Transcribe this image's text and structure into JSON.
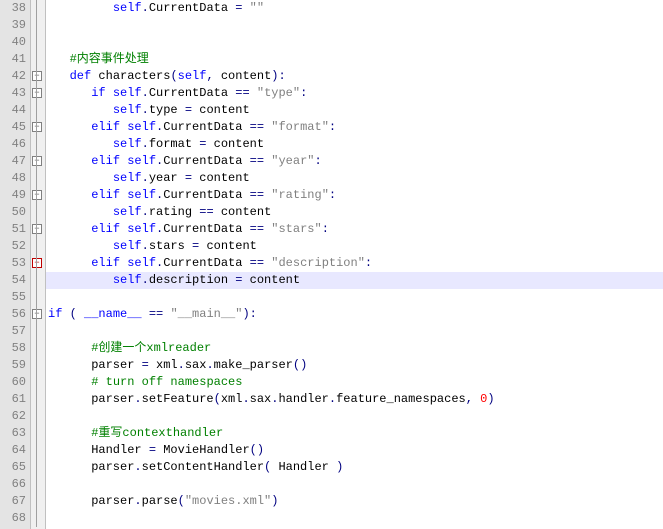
{
  "lines": [
    {
      "num": 38,
      "hl": false,
      "fold": "",
      "tokens": [
        [
          "plain",
          "         "
        ],
        [
          "kw",
          "self"
        ],
        [
          "op",
          "."
        ],
        [
          "plain",
          "CurrentData "
        ],
        [
          "op",
          "="
        ],
        [
          "plain",
          " "
        ],
        [
          "str",
          "\"\""
        ]
      ]
    },
    {
      "num": 39,
      "hl": false,
      "fold": "",
      "tokens": []
    },
    {
      "num": 40,
      "hl": false,
      "fold": "",
      "tokens": []
    },
    {
      "num": 41,
      "hl": false,
      "fold": "",
      "tokens": [
        [
          "plain",
          "   "
        ],
        [
          "comment",
          "#内容事件处理"
        ]
      ]
    },
    {
      "num": 42,
      "hl": false,
      "fold": "minus",
      "tokens": [
        [
          "plain",
          "   "
        ],
        [
          "kw",
          "def"
        ],
        [
          "plain",
          " "
        ],
        [
          "fn",
          "characters"
        ],
        [
          "op",
          "("
        ],
        [
          "kw",
          "self"
        ],
        [
          "op",
          ","
        ],
        [
          "plain",
          " content"
        ],
        [
          "op",
          ")"
        ],
        [
          "op",
          ":"
        ]
      ]
    },
    {
      "num": 43,
      "hl": false,
      "fold": "minus",
      "tokens": [
        [
          "plain",
          "      "
        ],
        [
          "kw",
          "if"
        ],
        [
          "plain",
          " "
        ],
        [
          "kw",
          "self"
        ],
        [
          "op",
          "."
        ],
        [
          "plain",
          "CurrentData "
        ],
        [
          "op",
          "=="
        ],
        [
          "plain",
          " "
        ],
        [
          "str",
          "\"type\""
        ],
        [
          "op",
          ":"
        ]
      ]
    },
    {
      "num": 44,
      "hl": false,
      "fold": "",
      "tokens": [
        [
          "plain",
          "         "
        ],
        [
          "kw",
          "self"
        ],
        [
          "op",
          "."
        ],
        [
          "plain",
          "type "
        ],
        [
          "op",
          "="
        ],
        [
          "plain",
          " content"
        ]
      ]
    },
    {
      "num": 45,
      "hl": false,
      "fold": "minus",
      "tokens": [
        [
          "plain",
          "      "
        ],
        [
          "kw",
          "elif"
        ],
        [
          "plain",
          " "
        ],
        [
          "kw",
          "self"
        ],
        [
          "op",
          "."
        ],
        [
          "plain",
          "CurrentData "
        ],
        [
          "op",
          "=="
        ],
        [
          "plain",
          " "
        ],
        [
          "str",
          "\"format\""
        ],
        [
          "op",
          ":"
        ]
      ]
    },
    {
      "num": 46,
      "hl": false,
      "fold": "",
      "tokens": [
        [
          "plain",
          "         "
        ],
        [
          "kw",
          "self"
        ],
        [
          "op",
          "."
        ],
        [
          "plain",
          "format "
        ],
        [
          "op",
          "="
        ],
        [
          "plain",
          " content"
        ]
      ]
    },
    {
      "num": 47,
      "hl": false,
      "fold": "minus",
      "tokens": [
        [
          "plain",
          "      "
        ],
        [
          "kw",
          "elif"
        ],
        [
          "plain",
          " "
        ],
        [
          "kw",
          "self"
        ],
        [
          "op",
          "."
        ],
        [
          "plain",
          "CurrentData "
        ],
        [
          "op",
          "=="
        ],
        [
          "plain",
          " "
        ],
        [
          "str",
          "\"year\""
        ],
        [
          "op",
          ":"
        ]
      ]
    },
    {
      "num": 48,
      "hl": false,
      "fold": "",
      "tokens": [
        [
          "plain",
          "         "
        ],
        [
          "kw",
          "self"
        ],
        [
          "op",
          "."
        ],
        [
          "plain",
          "year "
        ],
        [
          "op",
          "="
        ],
        [
          "plain",
          " content"
        ]
      ]
    },
    {
      "num": 49,
      "hl": false,
      "fold": "minus",
      "tokens": [
        [
          "plain",
          "      "
        ],
        [
          "kw",
          "elif"
        ],
        [
          "plain",
          " "
        ],
        [
          "kw",
          "self"
        ],
        [
          "op",
          "."
        ],
        [
          "plain",
          "CurrentData "
        ],
        [
          "op",
          "=="
        ],
        [
          "plain",
          " "
        ],
        [
          "str",
          "\"rating\""
        ],
        [
          "op",
          ":"
        ]
      ]
    },
    {
      "num": 50,
      "hl": false,
      "fold": "",
      "tokens": [
        [
          "plain",
          "         "
        ],
        [
          "kw",
          "self"
        ],
        [
          "op",
          "."
        ],
        [
          "plain",
          "rating "
        ],
        [
          "op",
          "=="
        ],
        [
          "plain",
          " content"
        ]
      ]
    },
    {
      "num": 51,
      "hl": false,
      "fold": "minus",
      "tokens": [
        [
          "plain",
          "      "
        ],
        [
          "kw",
          "elif"
        ],
        [
          "plain",
          " "
        ],
        [
          "kw",
          "self"
        ],
        [
          "op",
          "."
        ],
        [
          "plain",
          "CurrentData "
        ],
        [
          "op",
          "=="
        ],
        [
          "plain",
          " "
        ],
        [
          "str",
          "\"stars\""
        ],
        [
          "op",
          ":"
        ]
      ]
    },
    {
      "num": 52,
      "hl": false,
      "fold": "",
      "tokens": [
        [
          "plain",
          "         "
        ],
        [
          "kw",
          "self"
        ],
        [
          "op",
          "."
        ],
        [
          "plain",
          "stars "
        ],
        [
          "op",
          "="
        ],
        [
          "plain",
          " content"
        ]
      ]
    },
    {
      "num": 53,
      "hl": false,
      "fold": "minus-red",
      "tokens": [
        [
          "plain",
          "      "
        ],
        [
          "kw",
          "elif"
        ],
        [
          "plain",
          " "
        ],
        [
          "kw",
          "self"
        ],
        [
          "op",
          "."
        ],
        [
          "plain",
          "CurrentData "
        ],
        [
          "op",
          "=="
        ],
        [
          "plain",
          " "
        ],
        [
          "str",
          "\"description\""
        ],
        [
          "op",
          ":"
        ]
      ]
    },
    {
      "num": 54,
      "hl": true,
      "fold": "",
      "tokens": [
        [
          "plain",
          "         "
        ],
        [
          "kw",
          "self"
        ],
        [
          "op",
          "."
        ],
        [
          "plain",
          "description "
        ],
        [
          "op",
          "="
        ],
        [
          "plain",
          " content"
        ]
      ]
    },
    {
      "num": 55,
      "hl": false,
      "fold": "",
      "tokens": []
    },
    {
      "num": 56,
      "hl": false,
      "fold": "minus",
      "tokens": [
        [
          "kw",
          "if"
        ],
        [
          "plain",
          " "
        ],
        [
          "op",
          "("
        ],
        [
          "plain",
          " "
        ],
        [
          "kw",
          "__name__"
        ],
        [
          "plain",
          " "
        ],
        [
          "op",
          "=="
        ],
        [
          "plain",
          " "
        ],
        [
          "str",
          "\"__main__\""
        ],
        [
          "op",
          ")"
        ],
        [
          "op",
          ":"
        ]
      ]
    },
    {
      "num": 57,
      "hl": false,
      "fold": "",
      "tokens": []
    },
    {
      "num": 58,
      "hl": false,
      "fold": "",
      "tokens": [
        [
          "plain",
          "      "
        ],
        [
          "comment",
          "#创建一个xmlreader"
        ]
      ]
    },
    {
      "num": 59,
      "hl": false,
      "fold": "",
      "tokens": [
        [
          "plain",
          "      parser "
        ],
        [
          "op",
          "="
        ],
        [
          "plain",
          " xml"
        ],
        [
          "op",
          "."
        ],
        [
          "plain",
          "sax"
        ],
        [
          "op",
          "."
        ],
        [
          "plain",
          "make_parser"
        ],
        [
          "op",
          "("
        ],
        [
          "op",
          ")"
        ]
      ]
    },
    {
      "num": 60,
      "hl": false,
      "fold": "",
      "tokens": [
        [
          "plain",
          "      "
        ],
        [
          "comment",
          "# turn off namespaces"
        ]
      ]
    },
    {
      "num": 61,
      "hl": false,
      "fold": "",
      "tokens": [
        [
          "plain",
          "      parser"
        ],
        [
          "op",
          "."
        ],
        [
          "plain",
          "setFeature"
        ],
        [
          "op",
          "("
        ],
        [
          "plain",
          "xml"
        ],
        [
          "op",
          "."
        ],
        [
          "plain",
          "sax"
        ],
        [
          "op",
          "."
        ],
        [
          "plain",
          "handler"
        ],
        [
          "op",
          "."
        ],
        [
          "plain",
          "feature_namespaces"
        ],
        [
          "op",
          ","
        ],
        [
          "plain",
          " "
        ],
        [
          "num",
          "0"
        ],
        [
          "op",
          ")"
        ]
      ]
    },
    {
      "num": 62,
      "hl": false,
      "fold": "",
      "tokens": []
    },
    {
      "num": 63,
      "hl": false,
      "fold": "",
      "tokens": [
        [
          "plain",
          "      "
        ],
        [
          "comment",
          "#重写contexthandler"
        ]
      ]
    },
    {
      "num": 64,
      "hl": false,
      "fold": "",
      "tokens": [
        [
          "plain",
          "      Handler "
        ],
        [
          "op",
          "="
        ],
        [
          "plain",
          " MovieHandler"
        ],
        [
          "op",
          "("
        ],
        [
          "op",
          ")"
        ]
      ]
    },
    {
      "num": 65,
      "hl": false,
      "fold": "",
      "tokens": [
        [
          "plain",
          "      parser"
        ],
        [
          "op",
          "."
        ],
        [
          "plain",
          "setContentHandler"
        ],
        [
          "op",
          "("
        ],
        [
          "plain",
          " Handler "
        ],
        [
          "op",
          ")"
        ]
      ]
    },
    {
      "num": 66,
      "hl": false,
      "fold": "",
      "tokens": []
    },
    {
      "num": 67,
      "hl": false,
      "fold": "",
      "tokens": [
        [
          "plain",
          "      parser"
        ],
        [
          "op",
          "."
        ],
        [
          "plain",
          "parse"
        ],
        [
          "op",
          "("
        ],
        [
          "str",
          "\"movies.xml\""
        ],
        [
          "op",
          ")"
        ]
      ]
    },
    {
      "num": 68,
      "hl": false,
      "fold": "",
      "tokens": []
    }
  ]
}
